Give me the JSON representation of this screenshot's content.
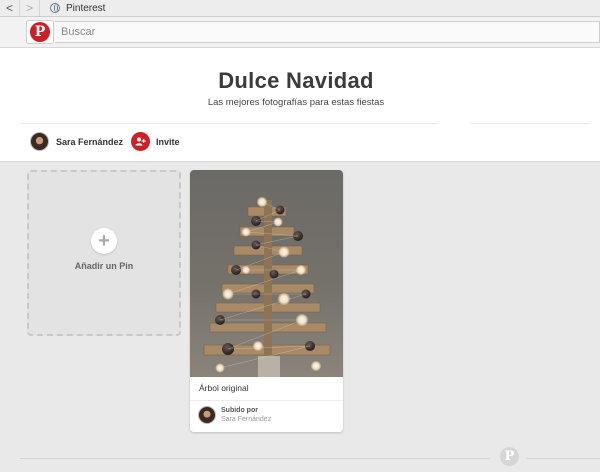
{
  "browser": {
    "back_glyph": "<",
    "forward_glyph": ">",
    "tab_title": "Pinterest"
  },
  "header": {
    "logo_glyph": "P",
    "search_placeholder": "Buscar"
  },
  "board": {
    "title": "Dulce Navidad",
    "description": "Las mejores fotografías para estas fiestas",
    "owner_name": "Sara Fernández",
    "invite_label": "Invite"
  },
  "add_pin": {
    "plus_glyph": "+",
    "label": "Añadir un Pin"
  },
  "pins": [
    {
      "description": "Árbol original",
      "credit_label": "Subido por",
      "credit_name": "Sara Fernández"
    }
  ],
  "footer": {
    "logo_glyph": "P"
  },
  "colors": {
    "brand_red": "#cb2027",
    "page_background": "#e9e9e9"
  }
}
